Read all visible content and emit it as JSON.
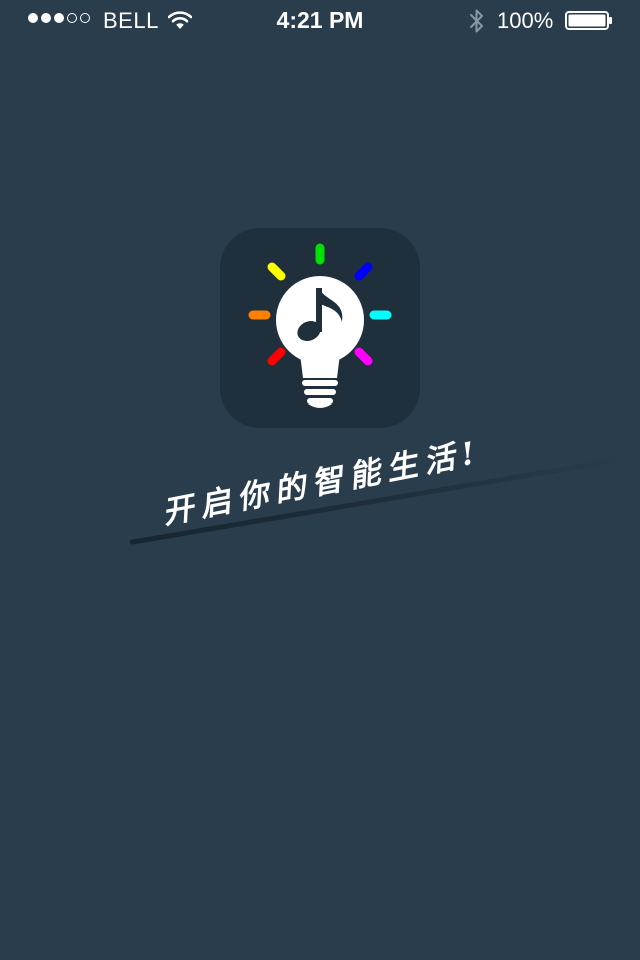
{
  "status_bar": {
    "signal_dots": [
      true,
      true,
      true,
      false,
      false
    ],
    "carrier": "BELL",
    "time": "4:21 PM",
    "battery_percent": "100%",
    "icons": [
      "wifi-icon",
      "bluetooth-icon",
      "battery-icon"
    ]
  },
  "splash": {
    "logo_icon": "lightbulb-music-note-icon",
    "ray_colors": [
      "#00e000",
      "#0000ff",
      "#00ffff",
      "#ff00ff",
      "#ff0000",
      "#ff8000",
      "#ffff00"
    ],
    "slogan": "开启你的智能生活!"
  },
  "colors": {
    "background": "#2a3d4c",
    "logo_tile": "#1f2f3c"
  }
}
